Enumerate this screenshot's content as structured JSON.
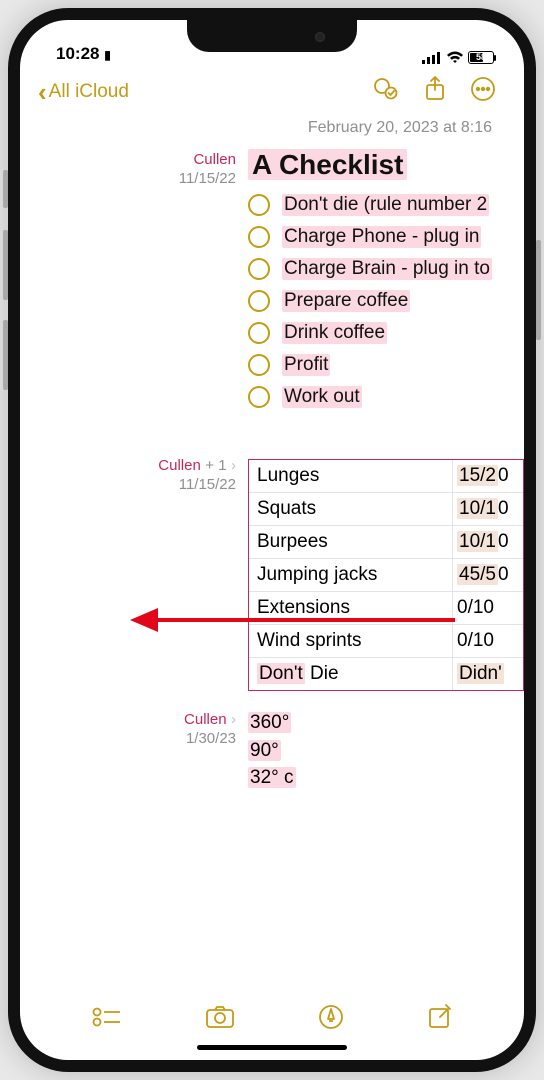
{
  "status": {
    "time": "10:28",
    "battery_pct": "58"
  },
  "nav": {
    "back_label": "All iCloud"
  },
  "timestamp": "February 20, 2023 at 8:16",
  "section1": {
    "author": "Cullen",
    "date": "11/15/22",
    "title": "A Checklist",
    "items": [
      "Don't die (rule number 2",
      "Charge Phone - plug in",
      "Charge Brain - plug in to",
      "Prepare coffee",
      "Drink coffee",
      "Profit",
      "Work out"
    ]
  },
  "section2": {
    "author": "Cullen",
    "plus": "+ 1",
    "date": "11/15/22",
    "rows": [
      {
        "a": "Lunges",
        "b_hl": "15/2",
        "b_tail": "0"
      },
      {
        "a": "Squats",
        "b_hl": "10/1",
        "b_tail": "0"
      },
      {
        "a": "Burpees",
        "b_hl": "10/1",
        "b_tail": "0"
      },
      {
        "a": "Jumping jacks",
        "b_hl": "45/5",
        "b_tail": "0"
      },
      {
        "a": "Extensions",
        "b_plain": "0/10"
      },
      {
        "a": "Wind sprints",
        "b_plain": "0/10"
      },
      {
        "a_hl": "Don't",
        "a_tail": " Die",
        "b_hl": "Didn'",
        "b_tail": ""
      }
    ]
  },
  "section3": {
    "author": "Cullen",
    "date": "1/30/23",
    "lines": [
      "360°",
      "90°",
      "32° c"
    ]
  }
}
